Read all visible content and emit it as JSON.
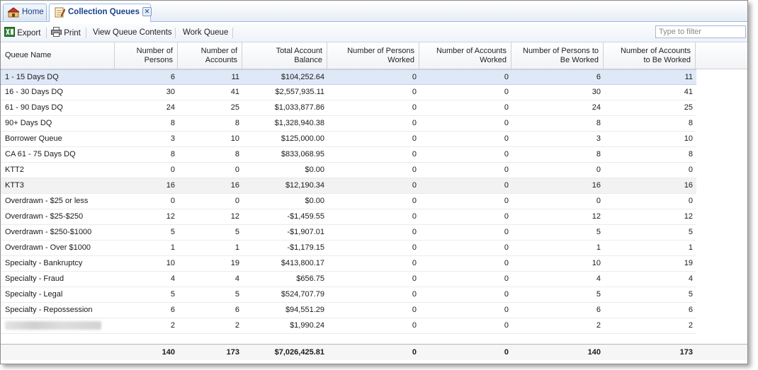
{
  "tabs": [
    {
      "label": "Home",
      "icon": "home-icon",
      "active": false
    },
    {
      "label": "Collection Queues",
      "icon": "notepad-icon",
      "active": true
    }
  ],
  "toolbar": {
    "export_label": "Export",
    "print_label": "Print",
    "view_label": "View Queue Contents",
    "work_label": "Work Queue",
    "filter_placeholder": "Type to filter"
  },
  "columns": [
    [
      "Queue Name"
    ],
    [
      "Number of",
      "Persons"
    ],
    [
      "Number of",
      "Accounts"
    ],
    [
      "Total Account",
      "Balance"
    ],
    [
      "Number of Persons",
      "Worked"
    ],
    [
      "Number of Accounts",
      "Worked"
    ],
    [
      "Number of Persons to",
      "Be Worked"
    ],
    [
      "Number of Accounts",
      "to Be Worked"
    ]
  ],
  "rows": [
    [
      "1 - 15 Days DQ",
      "6",
      "11",
      "$104,252.64",
      "0",
      "0",
      "6",
      "11"
    ],
    [
      "16 - 30 Days DQ",
      "30",
      "41",
      "$2,557,935.11",
      "0",
      "0",
      "30",
      "41"
    ],
    [
      "61 - 90 Days DQ",
      "24",
      "25",
      "$1,033,877.86",
      "0",
      "0",
      "24",
      "25"
    ],
    [
      "90+ Days DQ",
      "8",
      "8",
      "$1,328,940.38",
      "0",
      "0",
      "8",
      "8"
    ],
    [
      "Borrower Queue",
      "3",
      "10",
      "$125,000.00",
      "0",
      "0",
      "3",
      "10"
    ],
    [
      "CA 61 - 75 Days DQ",
      "8",
      "8",
      "$833,068.95",
      "0",
      "0",
      "8",
      "8"
    ],
    [
      "KTT2",
      "0",
      "0",
      "$0.00",
      "0",
      "0",
      "0",
      "0"
    ],
    [
      "KTT3",
      "16",
      "16",
      "$12,190.34",
      "0",
      "0",
      "16",
      "16"
    ],
    [
      "Overdrawn - $25 or less",
      "0",
      "0",
      "$0.00",
      "0",
      "0",
      "0",
      "0"
    ],
    [
      "Overdrawn - $25-$250",
      "12",
      "12",
      "-$1,459.55",
      "0",
      "0",
      "12",
      "12"
    ],
    [
      "Overdrawn - $250-$1000",
      "5",
      "5",
      "-$1,907.01",
      "0",
      "0",
      "5",
      "5"
    ],
    [
      "Overdrawn - Over $1000",
      "1",
      "1",
      "-$1,179.15",
      "0",
      "0",
      "1",
      "1"
    ],
    [
      "Specialty - Bankruptcy",
      "10",
      "19",
      "$413,800.17",
      "0",
      "0",
      "10",
      "19"
    ],
    [
      "Specialty - Fraud",
      "4",
      "4",
      "$656.75",
      "0",
      "0",
      "4",
      "4"
    ],
    [
      "Specialty - Legal",
      "5",
      "5",
      "$524,707.79",
      "0",
      "0",
      "5",
      "5"
    ],
    [
      "Specialty - Repossession",
      "6",
      "6",
      "$94,551.29",
      "0",
      "0",
      "6",
      "6"
    ],
    [
      "",
      "2",
      "2",
      "$1,990.24",
      "0",
      "0",
      "2",
      "2"
    ]
  ],
  "selected_row": 0,
  "highlighted_row": 7,
  "redacted_row": 16,
  "totals": [
    "",
    "140",
    "173",
    "$7,026,425.81",
    "0",
    "0",
    "140",
    "173"
  ],
  "colors": {
    "accent": "#15428b",
    "selected_row": "#dfe8f6",
    "header_border": "#99bbe8"
  }
}
